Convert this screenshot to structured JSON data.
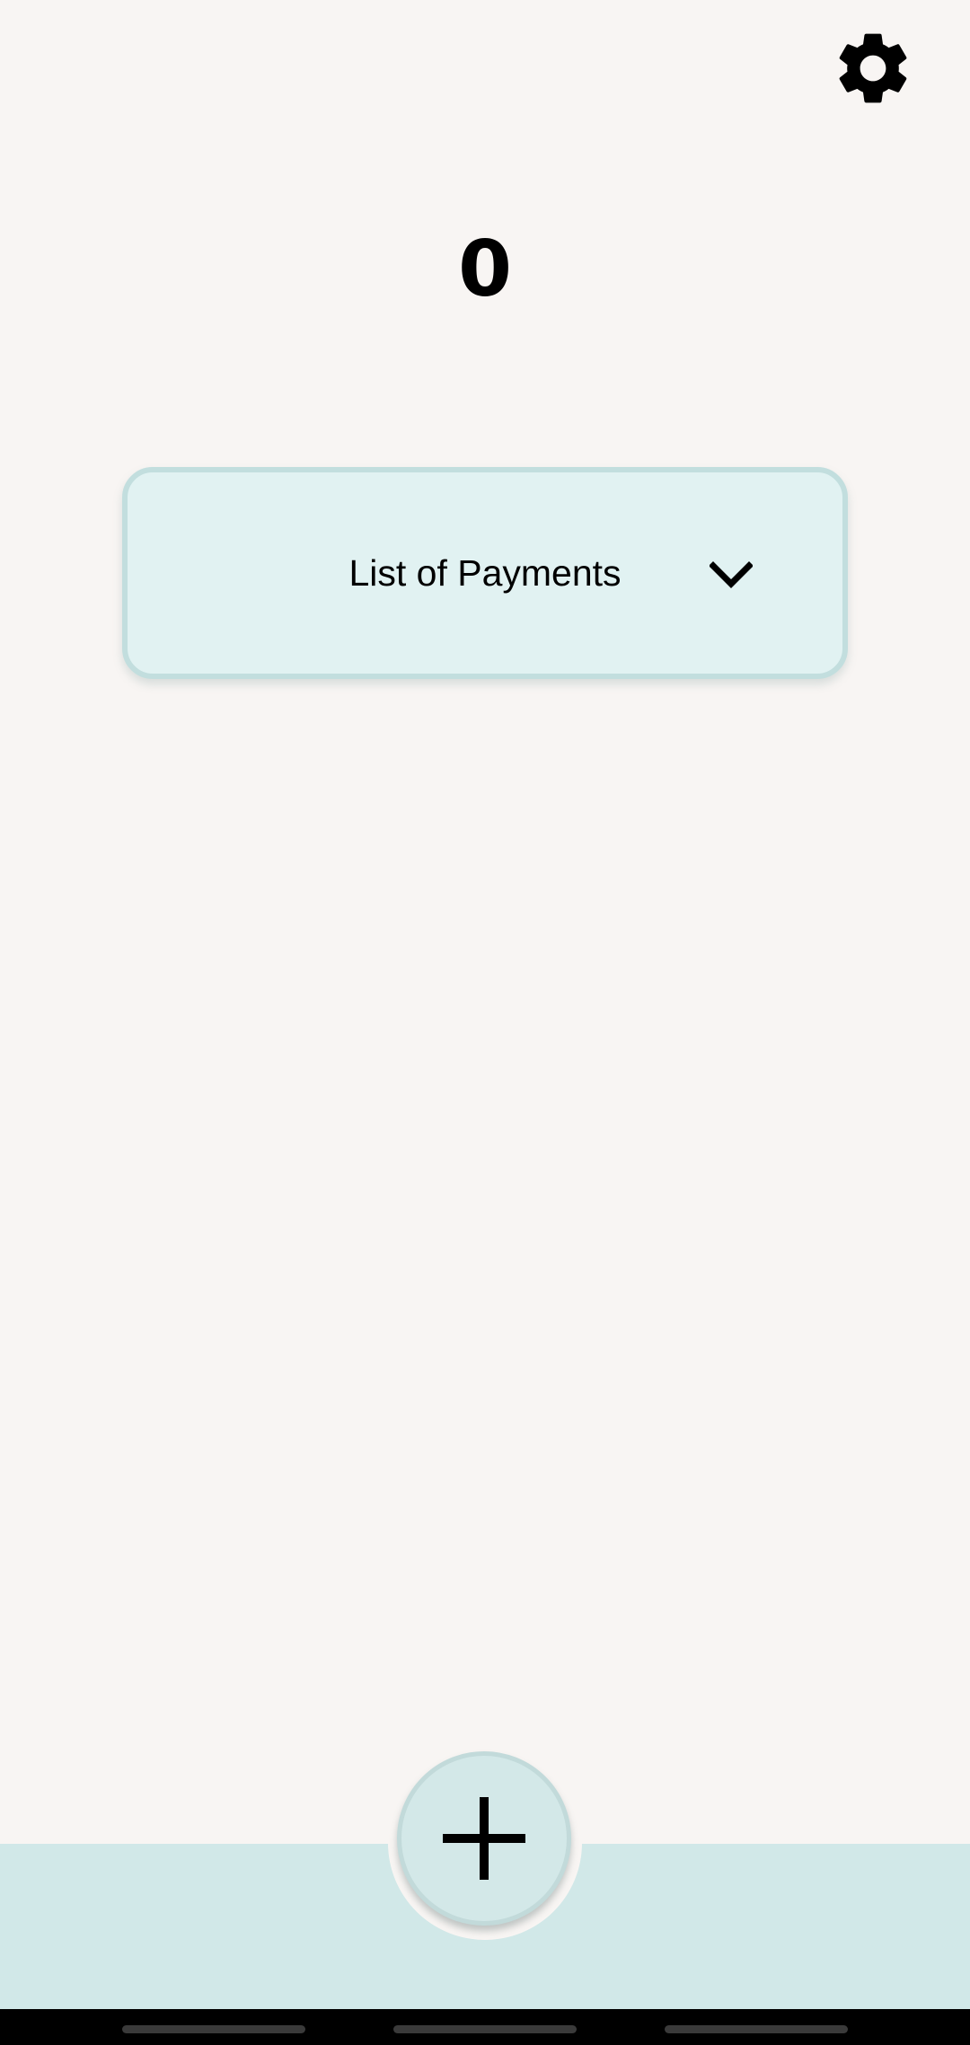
{
  "header": {
    "settings_icon": "gear-icon"
  },
  "summary": {
    "total": "0"
  },
  "payments": {
    "dropdown_label": "List of Payments",
    "dropdown_icon": "chevron-down-icon"
  },
  "actions": {
    "add_icon": "plus-icon"
  },
  "colors": {
    "background": "#f8f5f3",
    "accent_teal": "#e1f2f2",
    "bottom_bar": "#d1e8e8",
    "system_nav": "#000000"
  }
}
